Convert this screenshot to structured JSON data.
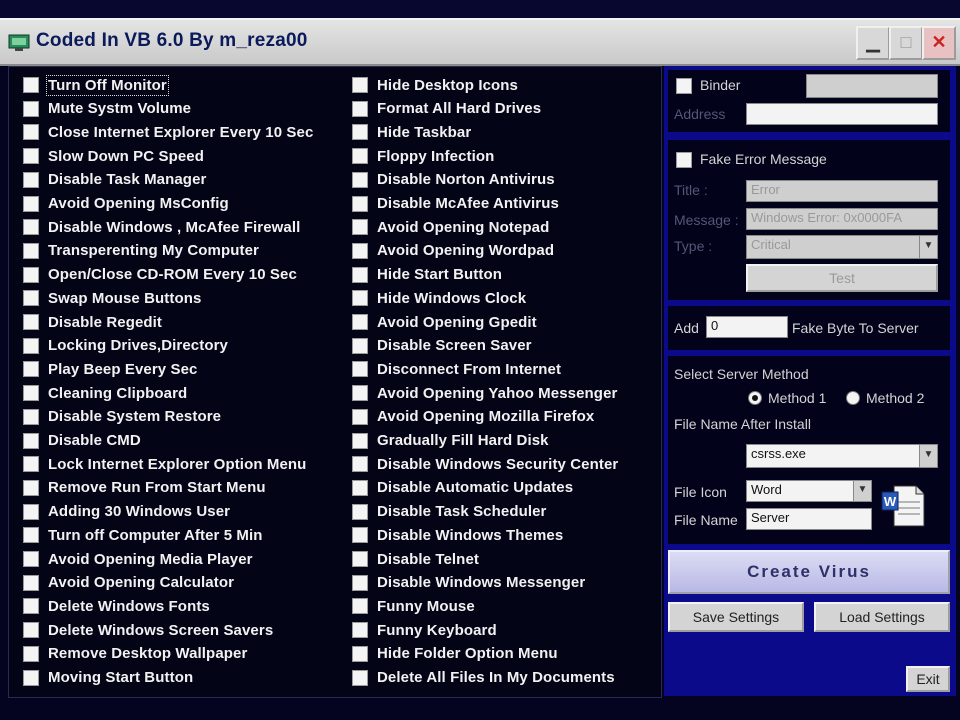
{
  "window": {
    "title": "Coded In VB 6.0 By m_reza00"
  },
  "left_options": [
    "Turn Off Monitor",
    "Mute Systm Volume",
    "Close Internet Explorer Every 10 Sec",
    "Slow Down PC Speed",
    "Disable Task Manager",
    "Avoid Opening MsConfig",
    "Disable Windows , McAfee Firewall",
    "Transperenting My Computer",
    "Open/Close CD-ROM Every 10 Sec",
    "Swap Mouse Buttons",
    "Disable Regedit",
    "Locking Drives,Directory",
    "Play Beep Every Sec",
    "Cleaning Clipboard",
    "Disable System Restore",
    "Disable CMD",
    "Lock Internet Explorer Option Menu",
    "Remove Run From Start Menu",
    "Adding 30 Windows User",
    "Turn off Computer After 5 Min",
    "Avoid Opening Media Player",
    "Avoid Opening Calculator",
    "Delete Windows Fonts",
    "Delete Windows Screen Savers",
    "Remove Desktop Wallpaper",
    "Moving Start Button"
  ],
  "middle_options": [
    "Hide Desktop Icons",
    "Format All Hard Drives",
    "Hide Taskbar",
    "Floppy Infection",
    "Disable Norton Antivirus",
    "Disable McAfee Antivirus",
    "Avoid Opening Notepad",
    "Avoid Opening Wordpad",
    "Hide Start Button",
    "Hide Windows Clock",
    "Avoid Opening Gpedit",
    "Disable Screen Saver",
    "Disconnect From Internet",
    "Avoid Opening Yahoo Messenger",
    "Avoid Opening Mozilla Firefox",
    "Gradually Fill Hard Disk",
    "Disable Windows Security Center",
    "Disable Automatic Updates",
    "Disable Task Scheduler",
    "Disable Windows Themes",
    "Disable Telnet",
    "Disable Windows Messenger",
    "Funny Mouse",
    "Funny Keyboard",
    "Hide Folder Option Menu",
    "Delete All Files In My Documents"
  ],
  "binder": {
    "label": "Binder",
    "address_label": "Address"
  },
  "fake_error": {
    "label": "Fake Error Message",
    "title_label": "Title :",
    "title_value": "Error",
    "message_label": "Message :",
    "message_value": "Windows Error: 0x0000FA",
    "type_label": "Type :",
    "type_value": "Critical",
    "test_label": "Test"
  },
  "fake_byte": {
    "prefix": "Add",
    "value": "0",
    "suffix": "Fake Byte To Server"
  },
  "server_method": {
    "label": "Select Server Method",
    "method1": "Method 1",
    "method2": "Method 2",
    "after_install_label": "File Name After Install",
    "after_install_value": "csrss.exe"
  },
  "file": {
    "icon_label": "File Icon",
    "icon_value": "Word",
    "name_label": "File Name",
    "name_value": "Server"
  },
  "buttons": {
    "create": "Create Virus",
    "save": "Save Settings",
    "load": "Load Settings",
    "exit": "Exit"
  }
}
